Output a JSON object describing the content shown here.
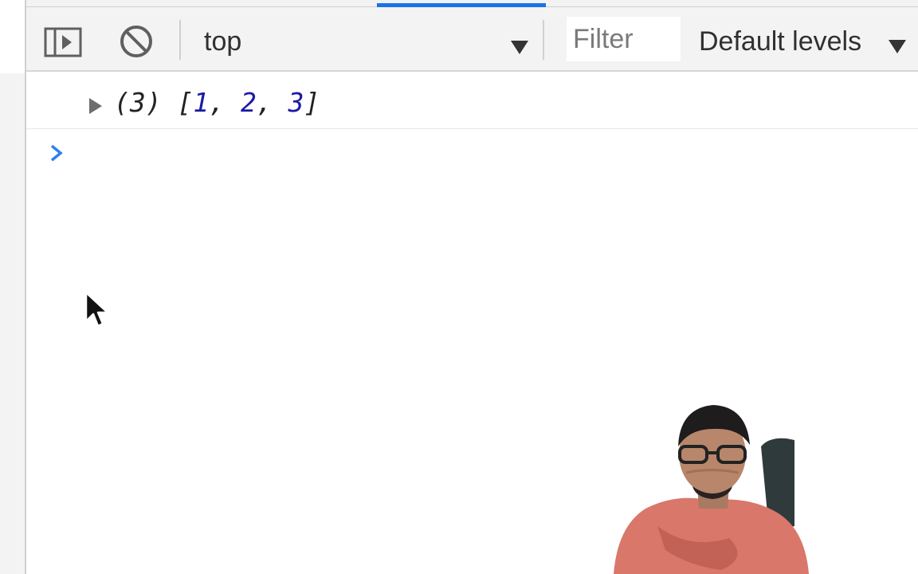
{
  "toolbar": {
    "context": "top",
    "filter_placeholder": "Filter",
    "levels": "Default levels"
  },
  "console": {
    "log_entry": {
      "length": "(3)",
      "open_bracket": "[",
      "values": [
        "1",
        "2",
        "3"
      ],
      "separator": ", ",
      "close_bracket": "]"
    }
  },
  "colors": {
    "accent": "#1a73e8",
    "toolbar_bg": "#f3f3f3",
    "number": "#1a1aa6"
  },
  "icons": [
    "sidebar-toggle-icon",
    "clear-console-icon",
    "dropdown-arrow-icon",
    "expand-arrow-icon",
    "prompt-chevron-icon",
    "mouse-cursor-icon"
  ]
}
